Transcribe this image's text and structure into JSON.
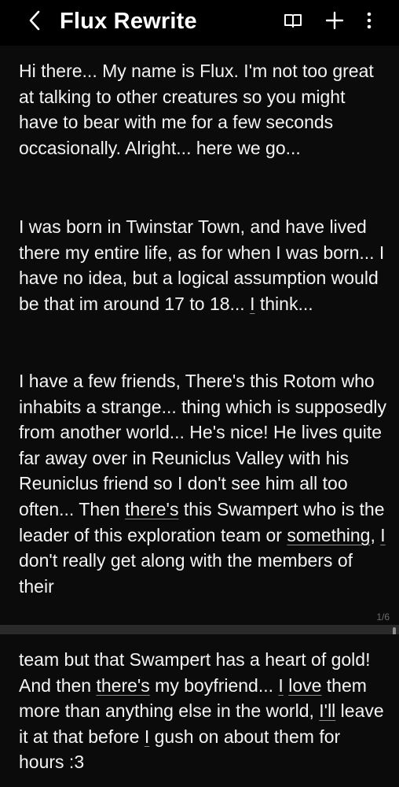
{
  "header": {
    "title": "Flux Rewrite",
    "icons": [
      "back-icon",
      "reader-mode-icon",
      "add-icon",
      "more-vertical-icon"
    ]
  },
  "document": {
    "page1": {
      "para1": "Hi there... My name is Flux. I'm not too great at talking to other creatures so you might have to bear with me for a few seconds occasionally. Alright... here we go...",
      "para2_before": "I was born in Twinstar Town, and have lived there my entire life, as for when I was born... I have no idea, but a logical assumption would be that im around 17 to 18... ",
      "para2_u1": "I",
      "para2_after": " think...",
      "para3_a": "I have a few friends, There's this Rotom who inhabits a strange... thing which is supposedly from another world... He's nice! He lives quite far away over in Reuniclus Valley with his Reuniclus friend so I don't see him all too often... Then ",
      "para3_u1": "there's",
      "para3_b": " this Swampert who is the leader of this exploration team or ",
      "para3_u2": "something",
      "para3_c": ", ",
      "para3_u3": "I",
      "para3_d": " don't really get along with the members of their",
      "page_indicator": "1/6"
    },
    "page2": {
      "p_a": "team but that Swampert has a heart of gold! And then ",
      "p_u1": "there's",
      "p_b": " my boyfriend... ",
      "p_u2": "I",
      "p_c": " ",
      "p_u3": "love",
      "p_d": " them more than anything else in the world, ",
      "p_u4": "I'll",
      "p_e": " leave it at that before ",
      "p_u5": "I",
      "p_f": " gush on about them for hours :3"
    }
  },
  "colors": {
    "background": "#000000",
    "page": "#0b0b0b",
    "text": "#f4f4f4",
    "separator": "#2a2a2a",
    "underline": "#8a8a8a"
  }
}
